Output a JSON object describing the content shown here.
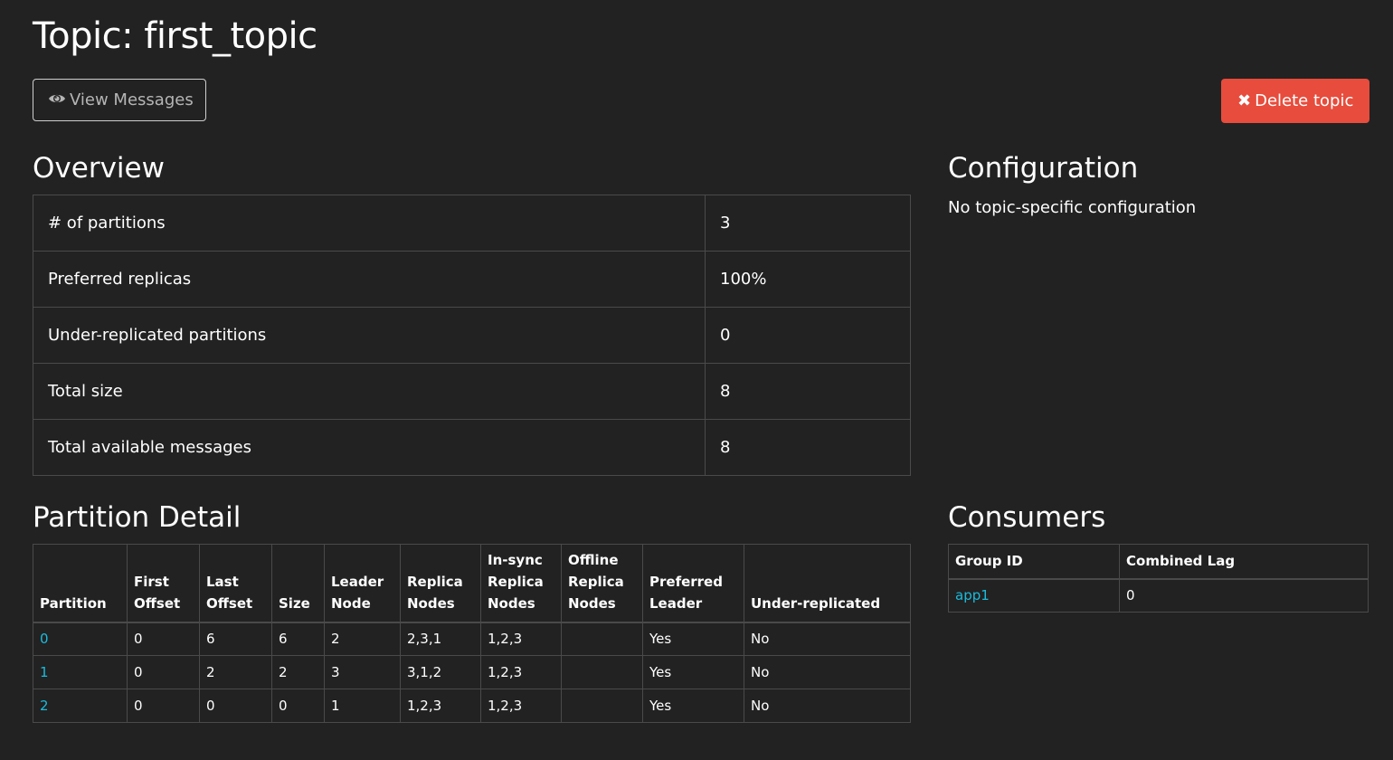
{
  "header": {
    "title": "Topic: first_topic",
    "view_messages_label": "View Messages",
    "delete_topic_label": "Delete topic",
    "delete_icon": "✖",
    "view_icon": "eye-icon"
  },
  "colors": {
    "background": "#222222",
    "danger": "#e74c3c",
    "link": "#1abcdc",
    "border": "#4a4a4a"
  },
  "overview": {
    "heading": "Overview",
    "rows": [
      {
        "label": "# of partitions",
        "value": "3"
      },
      {
        "label": "Preferred replicas",
        "value": "100%"
      },
      {
        "label": "Under-replicated partitions",
        "value": "0"
      },
      {
        "label": "Total size",
        "value": "8"
      },
      {
        "label": "Total available messages",
        "value": "8"
      }
    ]
  },
  "configuration": {
    "heading": "Configuration",
    "text": "No topic-specific configuration"
  },
  "partition_detail": {
    "heading": "Partition Detail",
    "columns": [
      [
        "Partition"
      ],
      [
        "First",
        "Offset"
      ],
      [
        "Last",
        "Offset"
      ],
      [
        "Size"
      ],
      [
        "Leader",
        "Node"
      ],
      [
        "Replica",
        "Nodes"
      ],
      [
        "In-sync",
        "Replica",
        "Nodes"
      ],
      [
        "Offline",
        "Replica",
        "Nodes"
      ],
      [
        "Preferred",
        "Leader"
      ],
      [
        "Under-replicated"
      ]
    ],
    "rows": [
      [
        "0",
        "0",
        "6",
        "6",
        "2",
        "2,3,1",
        "1,2,3",
        "",
        "Yes",
        "No"
      ],
      [
        "1",
        "0",
        "2",
        "2",
        "3",
        "3,1,2",
        "1,2,3",
        "",
        "Yes",
        "No"
      ],
      [
        "2",
        "0",
        "0",
        "0",
        "1",
        "1,2,3",
        "1,2,3",
        "",
        "Yes",
        "No"
      ]
    ]
  },
  "consumers": {
    "heading": "Consumers",
    "columns": [
      "Group ID",
      "Combined Lag"
    ],
    "rows": [
      [
        "app1",
        "0"
      ]
    ]
  }
}
